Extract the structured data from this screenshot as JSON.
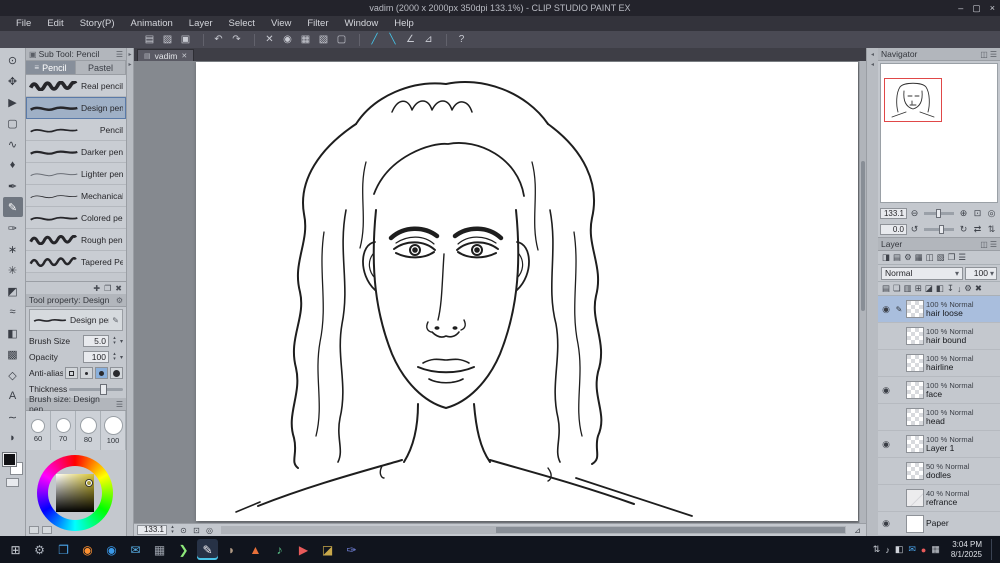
{
  "window": {
    "title": "vadim (2000 x 2000px 350dpi 133.1%)  - CLIP STUDIO PAINT EX",
    "btn_min": "–",
    "btn_max": "▢",
    "btn_close": "×"
  },
  "menubar": {
    "items": [
      "File",
      "Edit",
      "Story(P)",
      "Animation",
      "Layer",
      "Select",
      "View",
      "Filter",
      "Window",
      "Help"
    ]
  },
  "toolbar": {
    "icons": [
      "▤",
      "▨",
      "▣",
      "↶",
      "↷",
      "✕",
      "◉",
      "▦",
      "▧",
      "▢",
      "╱",
      "╲",
      "∠",
      "⊿",
      "?"
    ]
  },
  "tools": {
    "glyphs": [
      "⊙",
      "✥",
      "▶",
      "▢",
      "∿",
      "♦",
      "✒",
      "✎",
      "✑",
      "∗",
      "✳",
      "◩",
      "≈",
      "◧",
      "▩",
      "◇",
      "A",
      "∼",
      "◗"
    ]
  },
  "splitters": {
    "left": "▸",
    "right": "◂"
  },
  "subtool": {
    "title": "Sub Tool: Pencil",
    "header_icon": "▣",
    "menu_icon": "☰",
    "grip": "≡",
    "tabs": [
      "Pencil",
      "Pastel"
    ],
    "items": [
      "Real pencil",
      "Design pencil",
      "Pencil",
      "Darker pencil",
      "Lighter pencil",
      "Mechanical pencil",
      "Colored pencil",
      "Rough pencil",
      "Tapered Pencil"
    ],
    "footer_icons": [
      "✚",
      "❐",
      "✖"
    ]
  },
  "toolprop": {
    "title": "Tool property: Design",
    "gear": "⚙",
    "preset": "Design pencil",
    "edit_icon": "✎",
    "brush_size_label": "Brush Size",
    "brush_size": "5.0",
    "opacity_label": "Opacity",
    "opacity": "100",
    "antialias_label": "Anti-alias",
    "thickness_label": "Thickness",
    "spin_up": "▴",
    "spin_down": "▾",
    "picker": "▾"
  },
  "brushsize": {
    "title": "Brush size: Design pen...",
    "menu_icon": "☰",
    "sizes": [
      "60",
      "70",
      "80",
      "100"
    ]
  },
  "canvas": {
    "tab": "vadim",
    "tab_icon": "▤",
    "close": "✕",
    "zoom": "133.1",
    "spin_up": "▴",
    "spin_down": "▾",
    "icons": [
      "⊙",
      "⊡",
      "◎"
    ],
    "corner": "⊿"
  },
  "navigator": {
    "title": "Navigator",
    "icons": [
      "◫",
      "☰"
    ],
    "zoom": "133.1",
    "rotation": "0.0",
    "zoom_out": "⊖",
    "zoom_in": "⊕",
    "fit": "⊡",
    "actual": "◎",
    "rot_l": "↺",
    "rot_r": "↻",
    "flip_h": "⇄",
    "flip_v": "⇅"
  },
  "layers": {
    "title": "Layer",
    "icons": [
      "◫",
      "☰"
    ],
    "row_a": [
      "◨",
      "▤",
      "⚙",
      "▦",
      "◫",
      "▧",
      "❐",
      "☰"
    ],
    "blend": "Normal",
    "chev": "▾",
    "opacity": "100",
    "row_b": [
      "▤",
      "❏",
      "▥",
      "⊞",
      "◪",
      "◧",
      "↧",
      "↓",
      "⚙",
      "✖"
    ],
    "eye": "◉",
    "edit": "✎",
    "items": [
      {
        "meta": "100 % Normal",
        "name": "hair loose"
      },
      {
        "meta": "100 % Normal",
        "name": "hair bound"
      },
      {
        "meta": "100 % Normal",
        "name": "hairline"
      },
      {
        "meta": "100 % Normal",
        "name": "face"
      },
      {
        "meta": "100 % Normal",
        "name": "head"
      },
      {
        "meta": "100 % Normal",
        "name": "Layer 1"
      },
      {
        "meta": "50 % Normal",
        "name": "dodles"
      },
      {
        "meta": "40 % Normal",
        "name": "refrance"
      },
      {
        "meta": "",
        "name": "Paper"
      }
    ]
  },
  "taskbar": {
    "time": "3:04 PM",
    "date": "8/1/2025",
    "apps": [
      {
        "g": "⊞",
        "s": "color:#cfd3da"
      },
      {
        "g": "⚙",
        "s": "color:#aeb4be"
      },
      {
        "g": "❐",
        "s": "color:#4aa3e8"
      },
      {
        "g": "◉",
        "s": "color:#ff9232"
      },
      {
        "g": "◉",
        "s": "color:#3b99e8"
      },
      {
        "g": "✉",
        "s": "color:#58b0e8"
      },
      {
        "g": "▦",
        "s": "color:#9aa0aa"
      },
      {
        "g": "❯",
        "s": "color:#8de87a"
      },
      {
        "g": "✎",
        "s": "color:#f0eef2"
      },
      {
        "g": "◗",
        "s": "color:#b09a84"
      },
      {
        "g": "▲",
        "s": "color:#e8703a"
      },
      {
        "g": "♪",
        "s": "color:#5ac48a"
      },
      {
        "g": "▶",
        "s": "color:#e85a5a"
      },
      {
        "g": "◪",
        "s": "color:#c8a84a"
      },
      {
        "g": "✑",
        "s": "color:#7a8ae8"
      }
    ],
    "tray": [
      {
        "g": "⇅",
        "s": "color:#cfd3da"
      },
      {
        "g": "♪",
        "s": "color:#cfd3da"
      },
      {
        "g": "◧",
        "s": "color:#cfd3da"
      },
      {
        "g": "✉",
        "s": "color:#4aa3e8"
      },
      {
        "g": "●",
        "s": "color:#e85a5a"
      },
      {
        "g": "▦",
        "s": "color:#cfd3da"
      }
    ]
  }
}
